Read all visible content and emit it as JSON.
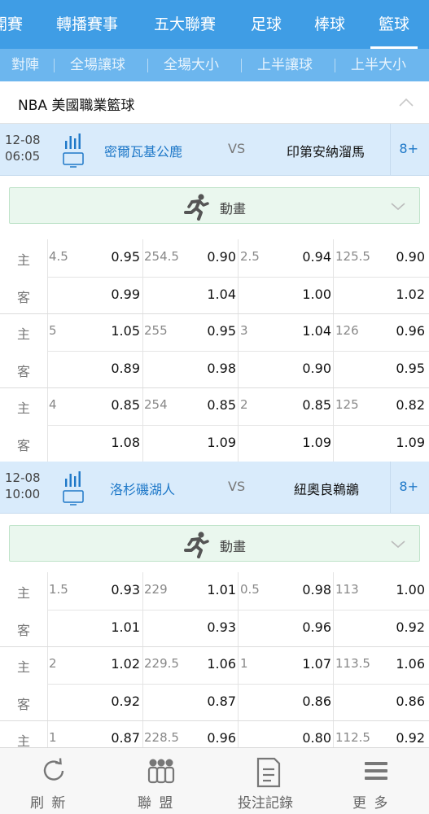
{
  "top_tabs": [
    "開賽",
    "轉播賽事",
    "五大聯賽",
    "足球",
    "棒球",
    "籃球"
  ],
  "active_top_tab": "籃球",
  "sub_tabs": [
    "對陣",
    "全場讓球",
    "全場大小",
    "上半讓球",
    "上半大小"
  ],
  "league": {
    "title": "NBA 美國職業籃球"
  },
  "matches": [
    {
      "date": "12-08",
      "time": "06:05",
      "home": "密爾瓦基公鹿",
      "vs": "VS",
      "away": "印第安納溜馬",
      "more": "8+",
      "animation_label": "動畫",
      "odds_groups": [
        {
          "home_label": "主",
          "away_label": "客",
          "hcp1": "4.5",
          "h1": "0.95",
          "a1": "0.99",
          "hcp2": "254.5",
          "h2": "0.90",
          "a2": "1.04",
          "hcp3": "2.5",
          "h3": "0.94",
          "a3": "1.00",
          "hcp4": "125.5",
          "h4": "0.90",
          "a4": "1.02"
        },
        {
          "home_label": "主",
          "away_label": "客",
          "hcp1": "5",
          "h1": "1.05",
          "a1": "0.89",
          "hcp2": "255",
          "h2": "0.95",
          "a2": "0.98",
          "hcp3": "3",
          "h3": "1.04",
          "a3": "0.90",
          "hcp4": "126",
          "h4": "0.96",
          "a4": "0.95"
        },
        {
          "home_label": "主",
          "away_label": "客",
          "hcp1": "4",
          "h1": "0.85",
          "a1": "1.08",
          "hcp2": "254",
          "h2": "0.85",
          "a2": "1.09",
          "hcp3": "2",
          "h3": "0.85",
          "a3": "1.09",
          "hcp4": "125",
          "h4": "0.82",
          "a4": "1.09"
        }
      ]
    },
    {
      "date": "12-08",
      "time": "10:00",
      "home": "洛杉磯湖人",
      "vs": "VS",
      "away": "紐奧良鵜鶘",
      "more": "8+",
      "animation_label": "動畫",
      "odds_groups": [
        {
          "home_label": "主",
          "away_label": "客",
          "hcp1": "1.5",
          "h1": "0.93",
          "a1": "1.01",
          "hcp2": "229",
          "h2": "1.01",
          "a2": "0.93",
          "hcp3": "0.5",
          "h3": "0.98",
          "a3": "0.96",
          "hcp4": "113",
          "h4": "1.00",
          "a4": "0.92"
        },
        {
          "home_label": "主",
          "away_label": "客",
          "hcp1": "2",
          "h1": "1.02",
          "a1": "0.92",
          "hcp2": "229.5",
          "h2": "1.06",
          "a2": "0.87",
          "hcp3": "1",
          "h3": "1.07",
          "a3": "0.86",
          "hcp4": "113.5",
          "h4": "1.06",
          "a4": "0.86"
        },
        {
          "home_label": "主",
          "away_label": "客",
          "hcp1": "1",
          "h1": "0.87",
          "a1": "",
          "hcp2": "228.5",
          "h2": "0.96",
          "a2": "",
          "hcp3": "",
          "h3": "0.80",
          "a3": "",
          "hcp4": "112.5",
          "h4": "0.92",
          "a4": ""
        }
      ]
    }
  ],
  "bottom_nav": [
    {
      "label": "刷 新",
      "icon": "refresh-icon"
    },
    {
      "label": "聯 盟",
      "icon": "league-icon"
    },
    {
      "label": "投注記錄",
      "icon": "bet-record-icon"
    },
    {
      "label": "更 多",
      "icon": "menu-icon"
    }
  ],
  "colors": {
    "primary": "#3f9de5",
    "subnav": "#6cb6ee",
    "match_bg": "#d9ebfb",
    "link": "#1e78c8",
    "animation_bg": "#eaf7ee"
  }
}
